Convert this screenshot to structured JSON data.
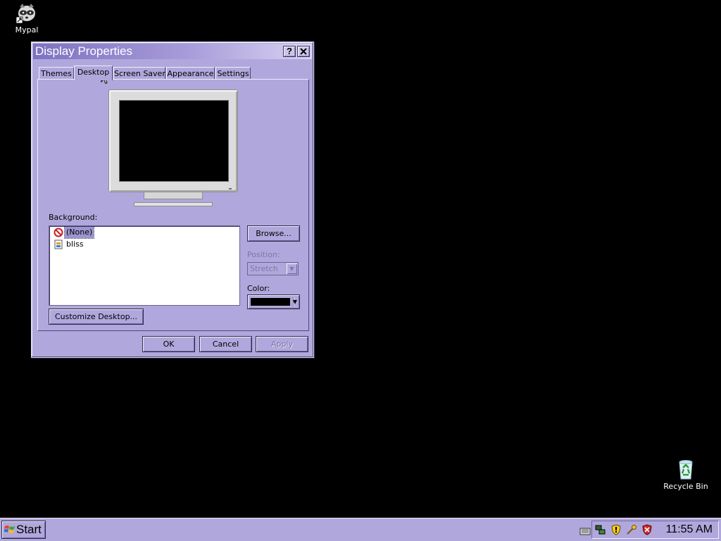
{
  "desktop": {
    "icons": [
      {
        "label": "Mypal",
        "icon": "raccoon-shortcut-icon"
      },
      {
        "label": "Recycle Bin",
        "icon": "recycle-bin-icon"
      }
    ]
  },
  "dialog": {
    "title": "Display Properties",
    "help_button": "?",
    "close_button": "✕",
    "tabs": [
      {
        "label": "Themes"
      },
      {
        "label": "Desktop"
      },
      {
        "label": "Screen Saver"
      },
      {
        "label": "Appearance"
      },
      {
        "label": "Settings"
      }
    ],
    "active_tab": "Desktop",
    "background_label": "Background:",
    "background_items": [
      {
        "label": "(None)",
        "icon": "no-wallpaper-icon",
        "selected": true
      },
      {
        "label": "bliss",
        "icon": "image-file-icon",
        "selected": false
      }
    ],
    "browse_button": "Browse...",
    "position_label": "Position:",
    "position_value": "Stretch",
    "color_label": "Color:",
    "color_value": "#000000",
    "customize_button": "Customize Desktop...",
    "ok_button": "OK",
    "cancel_button": "Cancel",
    "apply_button": "Apply"
  },
  "taskbar": {
    "start_label": "Start",
    "clock": "11:55 AM",
    "tray_icons": [
      "keyboard-icon",
      "network-icon",
      "security-shield-icon",
      "tools-icon",
      "antivirus-shield-icon"
    ]
  },
  "colors": {
    "desktop_bg": "#000000",
    "window_face": "#b0a8dc",
    "title_gradient_start": "#7d72c2",
    "title_gradient_end": "#d9d2f2",
    "list_selection": "#9d95d0"
  }
}
